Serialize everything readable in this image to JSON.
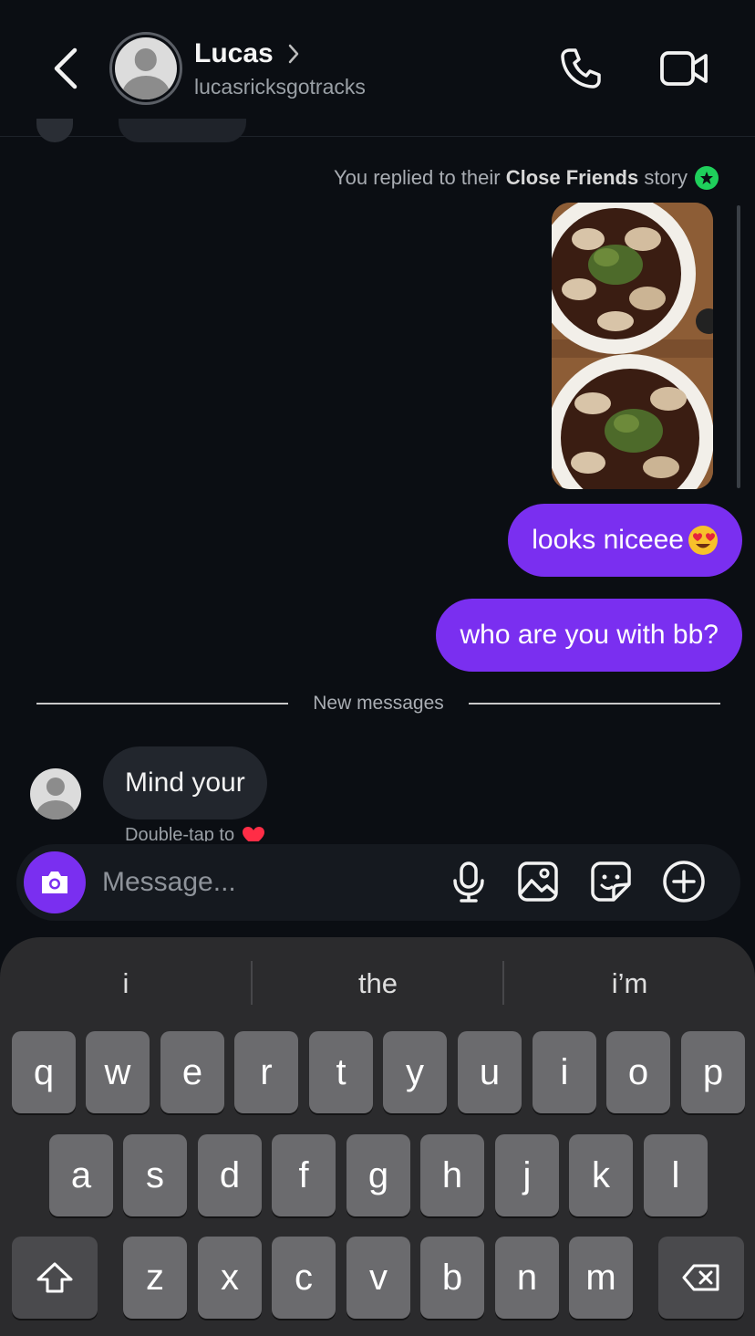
{
  "header": {
    "contact_name": "Lucas",
    "contact_handle": "lucasricksgotracks"
  },
  "conversation": {
    "story_reply_prefix": "You replied to their ",
    "story_reply_bold": "Close Friends",
    "story_reply_suffix": " story",
    "outgoing": [
      {
        "text": "looks niceee",
        "emoji": "heart-eyes"
      },
      {
        "text": "who are you with bb?"
      }
    ],
    "divider_label": "New messages",
    "incoming": [
      {
        "text": "Mind your",
        "hint": "Double-tap to"
      }
    ]
  },
  "composer": {
    "placeholder": "Message..."
  },
  "keyboard": {
    "suggestions": [
      "i",
      "the",
      "i’m"
    ],
    "row1": [
      "q",
      "w",
      "e",
      "r",
      "t",
      "y",
      "u",
      "i",
      "o",
      "p"
    ],
    "row2": [
      "a",
      "s",
      "d",
      "f",
      "g",
      "h",
      "j",
      "k",
      "l"
    ],
    "row3": [
      "z",
      "x",
      "c",
      "v",
      "b",
      "n",
      "m"
    ]
  },
  "colors": {
    "accent": "#7a2ff0",
    "close_friends": "#1fcf5b",
    "background": "#0b0e13"
  }
}
